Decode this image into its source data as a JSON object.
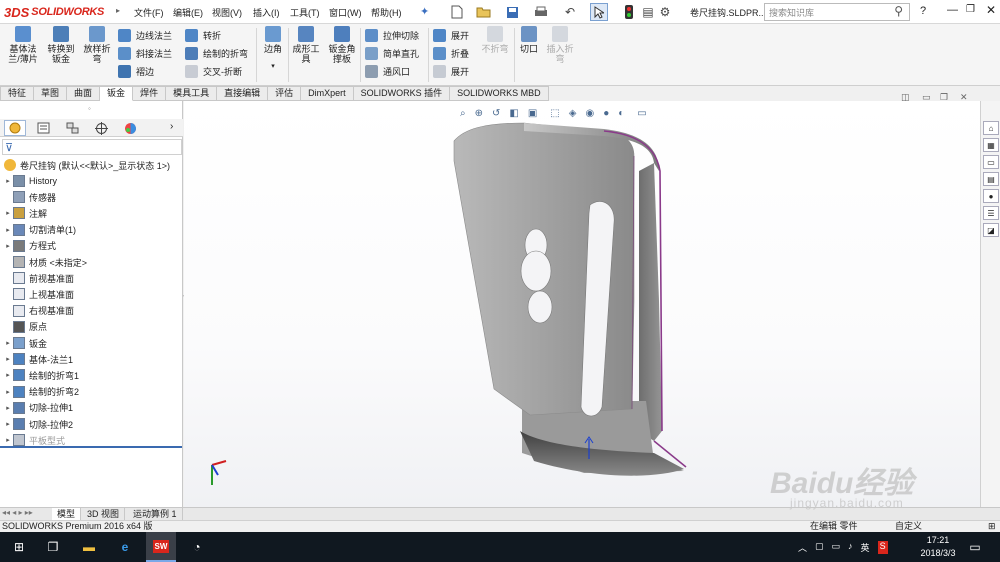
{
  "app": {
    "brand_mark": "3DS",
    "brand_name": "SOLIDWORKS"
  },
  "menu": [
    "文件(F)",
    "编辑(E)",
    "视图(V)",
    "插入(I)",
    "工具(T)",
    "窗口(W)",
    "帮助(H)"
  ],
  "document_title": "卷尺挂钩.SLDPR...",
  "search": {
    "placeholder": "搜索知识库"
  },
  "ribbon": {
    "base_flange": "基体法兰/薄片",
    "convert_to_sheet": "转换到钣金",
    "lofted_bend": "放样折弯",
    "edge_flange": "边线法兰",
    "miter_flange": "斜接法兰",
    "hem": "褶边",
    "jog": "转折",
    "sketched_bend": "绘制的折弯",
    "cross_break": "交叉-折断",
    "corners": "边角",
    "forming_tool": "成形工具",
    "gusset": "钣金角撑板",
    "extruded_cut": "拉伸切除",
    "simple_hole": "简单直孔",
    "vent": "通风口",
    "unfold": "展开",
    "fold": "折叠",
    "flatten": "展开",
    "no_bends": "不折弯",
    "rip": "切口",
    "insert_bends": "插入折弯"
  },
  "command_tabs": [
    "特征",
    "草图",
    "曲面",
    "钣金",
    "焊件",
    "模具工具",
    "直接编辑",
    "评估",
    "DimXpert",
    "SOLIDWORKS 插件",
    "SOLIDWORKS MBD"
  ],
  "active_tab": "钣金",
  "tree": {
    "root": "卷尺挂钩  (默认<<默认>_显示状态 1>)",
    "items": [
      {
        "label": "History",
        "icon": "history-icon",
        "expand": true
      },
      {
        "label": "传感器",
        "icon": "sensor-icon",
        "expand": false
      },
      {
        "label": "注解",
        "icon": "annotation-icon",
        "expand": true
      },
      {
        "label": "切割清单(1)",
        "icon": "cutlist-icon",
        "expand": true
      },
      {
        "label": "方程式",
        "icon": "equation-icon",
        "expand": true
      },
      {
        "label": "材质 <未指定>",
        "icon": "material-icon",
        "expand": false
      },
      {
        "label": "前视基准面",
        "icon": "plane-icon",
        "expand": false
      },
      {
        "label": "上视基准面",
        "icon": "plane-icon",
        "expand": false
      },
      {
        "label": "右视基准面",
        "icon": "plane-icon",
        "expand": false
      },
      {
        "label": "原点",
        "icon": "origin-icon",
        "expand": false
      },
      {
        "label": "钣金",
        "icon": "sheetmetal-icon",
        "expand": true
      },
      {
        "label": "基体-法兰1",
        "icon": "baseflange-icon",
        "expand": true
      },
      {
        "label": "绘制的折弯1",
        "icon": "sketchedbend-icon",
        "expand": true
      },
      {
        "label": "绘制的折弯2",
        "icon": "sketchedbend-icon",
        "expand": true
      },
      {
        "label": "切除-拉伸1",
        "icon": "cut-icon",
        "expand": true
      },
      {
        "label": "切除-拉伸2",
        "icon": "cut-icon",
        "expand": true
      },
      {
        "label": "平板型式",
        "icon": "flatpattern-icon",
        "expand": true,
        "grayed": true
      }
    ]
  },
  "bottom_tabs": [
    "模型",
    "3D 视图",
    "运动算例 1"
  ],
  "status": {
    "text": "SOLIDWORKS Premium 2016 x64 版",
    "right1": "在编辑 零件",
    "right2": "自定义"
  },
  "taskbar": {
    "time": "17:21",
    "date": "2018/3/3",
    "ime": "英"
  },
  "watermark": {
    "text": "Baidu经验",
    "url": "jingyan.baidu.com"
  },
  "colors": {
    "brand": "#d9261c",
    "taskbar": "#101820",
    "part": "#9a9a9a",
    "edge": "#8a3a8a"
  }
}
